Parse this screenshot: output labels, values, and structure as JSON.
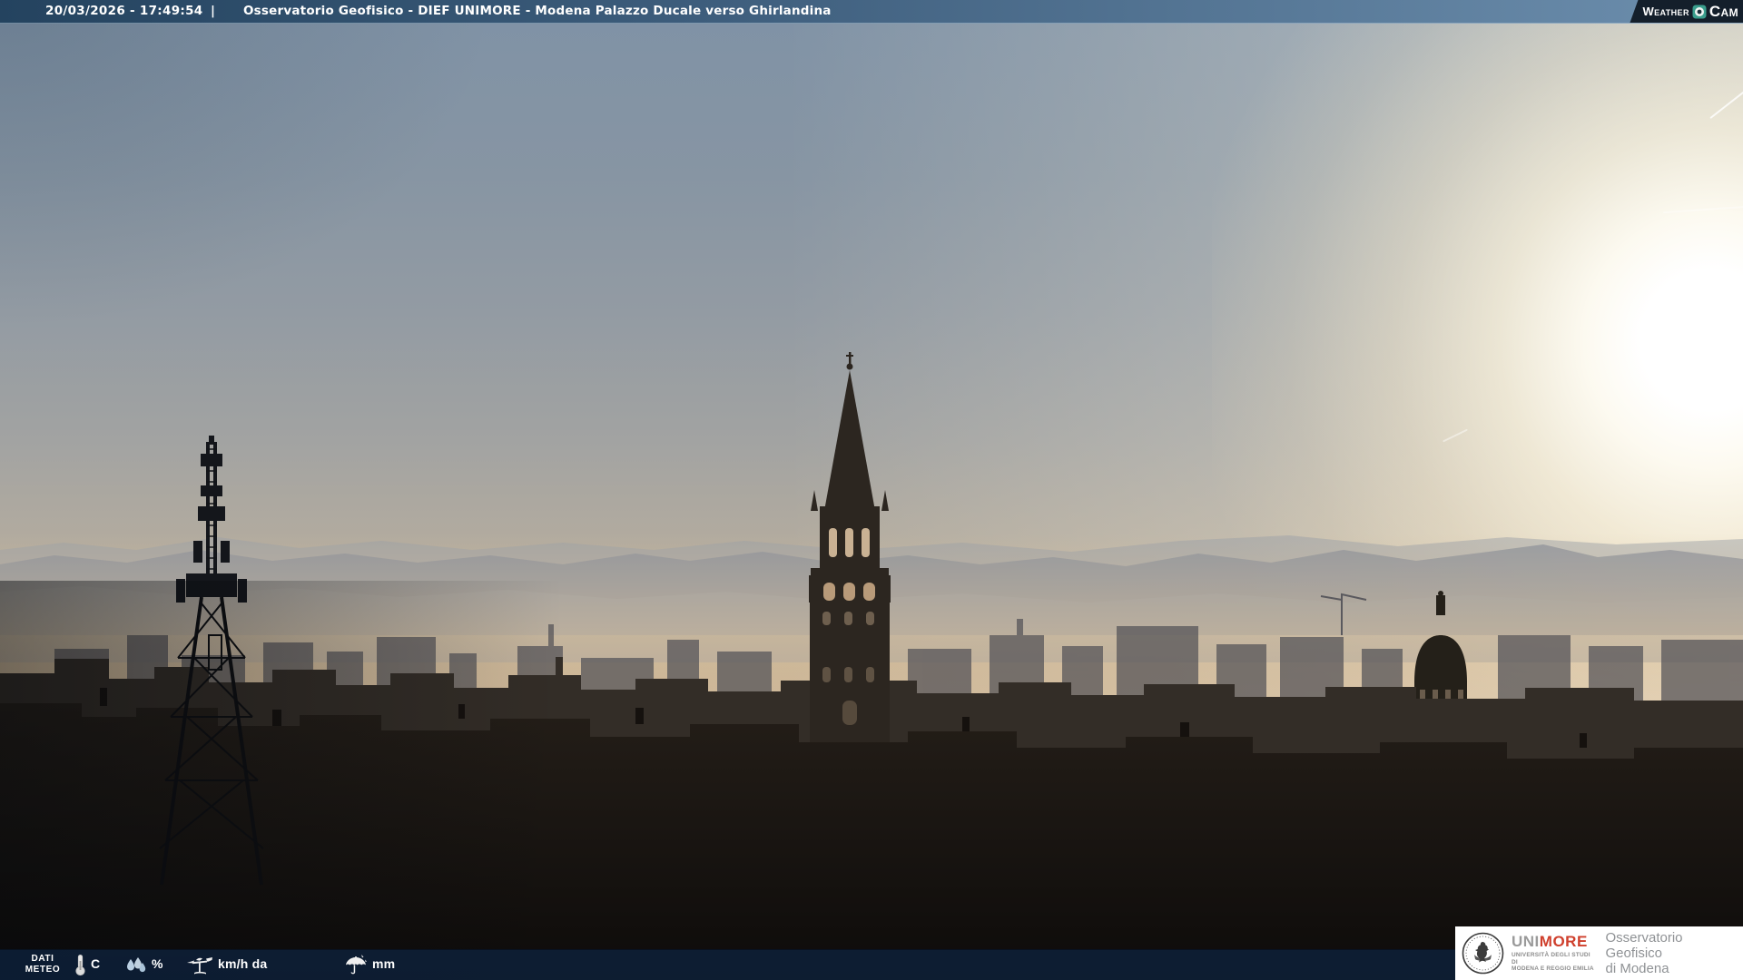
{
  "header": {
    "datetime": "20/03/2026 - 17:49:54",
    "separator": "|",
    "title": "Osservatorio Geofisico - DIEF UNIMORE - Modena Palazzo Ducale verso Ghirlandina",
    "weathercam": {
      "weather": "Weather",
      "cam": "Cam"
    }
  },
  "scene": {
    "description": "Webcam frame over Modena at sunset: Ghirlandina tower silhouetted at centre, lattice antenna tower on the left, church dome on the right, Apennine ridge hazy on the horizon, low sun glowing upper right, faint contrails",
    "landmarks": [
      "antenna-tower",
      "ghirlandina-tower",
      "church-dome",
      "apennine-ridge",
      "sun-glow",
      "contrails",
      "city-rooftops"
    ]
  },
  "footer": {
    "label_line1": "DATI",
    "label_line2": "METEO",
    "metrics": [
      {
        "icon": "thermometer-icon",
        "value": "",
        "unit": "C"
      },
      {
        "icon": "humidity-drops-icon",
        "value": "",
        "unit": "%"
      },
      {
        "icon": "wind-vane-icon",
        "value": "",
        "unit": "km/h da"
      },
      {
        "icon": "rain-umbrella-icon",
        "value": "",
        "unit": "mm"
      }
    ]
  },
  "branding": {
    "uni": "UNI",
    "more": "MORE",
    "university_line1": "UNIVERSITÀ DEGLI STUDI DI",
    "university_line2": "MODENA E REGGIO EMILIA",
    "observatory_line1": "Osservatorio Geofisico",
    "observatory_line2": "di Modena"
  },
  "colors": {
    "header-left": "#24435f",
    "header-right": "#6d8fae",
    "weathercam-bg": "#141f2b",
    "weathercam-accent": "#3a9e8d",
    "footer-bg": "rgba(14,33,59,0.82)",
    "unimore-red": "#cf3f2c",
    "unimore-gray": "#9a9a9a",
    "observatory-gray": "#8f9295",
    "sky-top": "#7f92a6",
    "sky-horizon": "#d8c2a2",
    "city-dark": "#17130f"
  }
}
